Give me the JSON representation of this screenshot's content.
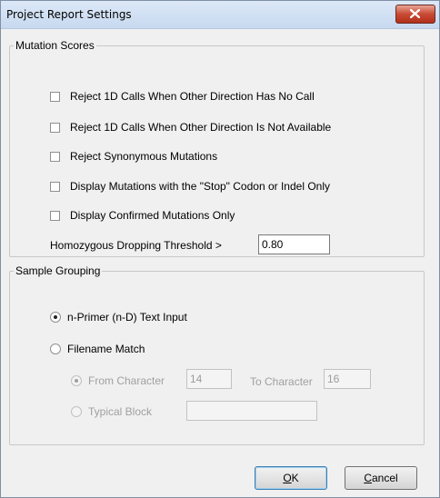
{
  "window": {
    "title": "Project Report Settings"
  },
  "mutation_scores": {
    "legend": "Mutation Scores",
    "options": [
      {
        "label": "Reject 1D Calls When Other Direction Has No Call",
        "checked": false
      },
      {
        "label": "Reject 1D Calls When Other Direction Is Not Available",
        "checked": false
      },
      {
        "label": "Reject Synonymous Mutations",
        "checked": false
      },
      {
        "label": "Display Mutations with the \"Stop\" Codon or Indel Only",
        "checked": false
      },
      {
        "label": "Display Confirmed Mutations Only",
        "checked": false
      }
    ],
    "threshold_label": "Homozygous Dropping Threshold >",
    "threshold_value": "0.80"
  },
  "sample_grouping": {
    "legend": "Sample Grouping",
    "n_primer_label": "n-Primer (n-D) Text Input",
    "filename_match_label": "Filename Match",
    "selected": "n-Primer (n-D) Text Input",
    "from_character_label": "From Character",
    "from_character_value": "14",
    "to_character_label": "To Character",
    "to_character_value": "16",
    "typical_block_label": "Typical Block",
    "typical_block_value": "",
    "sub_selected": "From Character"
  },
  "buttons": {
    "ok_prefix": "O",
    "ok_rest": "K",
    "cancel_prefix": "C",
    "cancel_rest": "ancel"
  }
}
